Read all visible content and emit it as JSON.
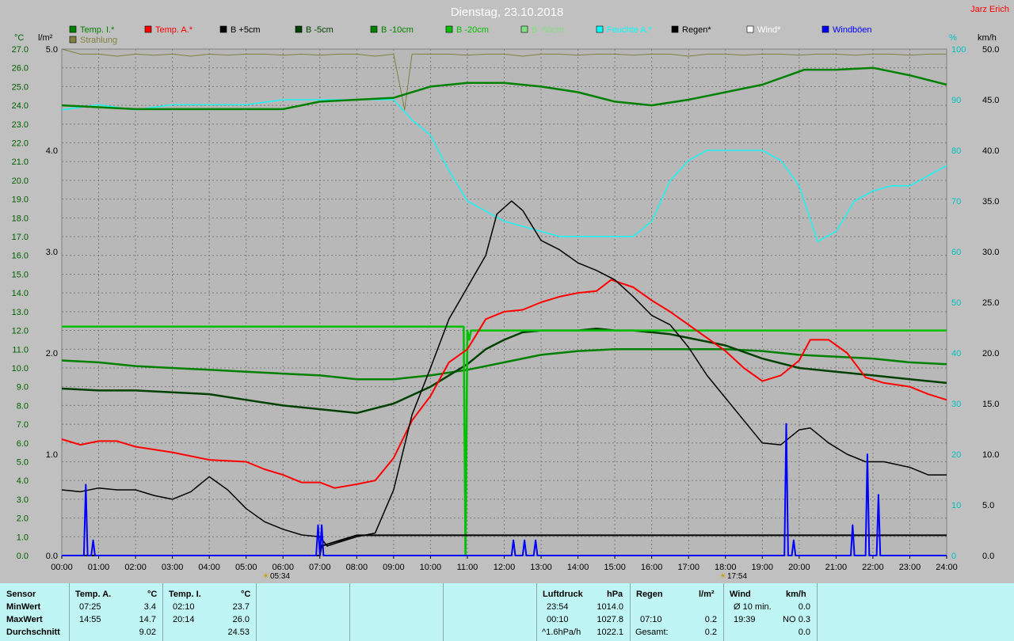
{
  "title": "Dienstag, 23.10.2018",
  "author": "Jarz Erich",
  "axis_units": {
    "temp": "°C",
    "rain": "l/m²",
    "humidity": "%",
    "wind": "km/h"
  },
  "legend": [
    {
      "label": "Temp. I.*",
      "color": "#008000"
    },
    {
      "label": "Temp. A.*",
      "color": "#ff0000"
    },
    {
      "label": "B +5cm",
      "color": "#000000"
    },
    {
      "label": "B -5cm",
      "color": "#004000"
    },
    {
      "label": "B -10cm",
      "color": "#008000"
    },
    {
      "label": "B -20cm",
      "color": "#00c000"
    },
    {
      "label": "B -50cm",
      "color": "#80e080"
    },
    {
      "label": "Feuchte A.*",
      "color": "#00ffff"
    },
    {
      "label": "Regen*",
      "color": "#000000"
    },
    {
      "label": "Wind*",
      "color": "#ffffff"
    },
    {
      "label": "Windböen",
      "color": "#0000ff"
    },
    {
      "label": "Strahlung",
      "color": "#808040"
    }
  ],
  "sun": {
    "sunrise": "05:34",
    "sunset": "17:54"
  },
  "chart_data": {
    "type": "line",
    "x_unit": "hours",
    "xlim": [
      0,
      24
    ],
    "x_ticks": [
      "00:00",
      "01:00",
      "02:00",
      "03:00",
      "04:00",
      "05:00",
      "06:00",
      "07:00",
      "08:00",
      "09:00",
      "10:00",
      "11:00",
      "12:00",
      "13:00",
      "14:00",
      "15:00",
      "16:00",
      "17:00",
      "18:00",
      "19:00",
      "20:00",
      "21:00",
      "22:00",
      "23:00",
      "24:00"
    ],
    "ylim_temp": [
      0,
      27
    ],
    "y_ticks_temp": [
      "0.0",
      "1.0",
      "2.0",
      "3.0",
      "4.0",
      "5.0",
      "6.0",
      "7.0",
      "8.0",
      "9.0",
      "10.0",
      "11.0",
      "12.0",
      "13.0",
      "14.0",
      "15.0",
      "16.0",
      "17.0",
      "18.0",
      "19.0",
      "20.0",
      "21.0",
      "22.0",
      "23.0",
      "24.0",
      "25.0",
      "26.0",
      "27.0"
    ],
    "ylim_rain": [
      0,
      5
    ],
    "y_ticks_rain": [
      "0.0",
      "1.0",
      "2.0",
      "3.0",
      "4.0",
      "5.0"
    ],
    "ylim_humidity": [
      0,
      100
    ],
    "y_ticks_humidity": [
      "0",
      "10",
      "20",
      "30",
      "40",
      "50",
      "60",
      "70",
      "80",
      "90",
      "100"
    ],
    "ylim_wind": [
      0,
      50
    ],
    "y_ticks_wind": [
      "0.0",
      "5.0",
      "10.0",
      "15.0",
      "20.0",
      "25.0",
      "30.0",
      "35.0",
      "40.0",
      "45.0",
      "50.0"
    ],
    "grid": true,
    "series": [
      {
        "name": "Temp. I.*",
        "axis": "temp",
        "color": "#008000",
        "x": [
          0,
          1,
          2,
          3,
          4,
          5,
          6,
          7,
          8,
          9,
          10,
          11,
          12,
          13,
          14,
          15,
          16,
          17,
          18,
          19,
          20,
          20.14,
          21,
          22,
          23,
          24
        ],
        "y": [
          24.0,
          23.9,
          23.8,
          23.8,
          23.8,
          23.8,
          23.8,
          24.2,
          24.3,
          24.4,
          25.0,
          25.2,
          25.2,
          25.0,
          24.7,
          24.2,
          24.0,
          24.3,
          24.7,
          25.1,
          25.8,
          25.9,
          25.9,
          26.0,
          25.6,
          25.1
        ]
      },
      {
        "name": "Temp. A.*",
        "axis": "temp",
        "color": "#ff0000",
        "x": [
          0,
          0.5,
          1,
          1.5,
          2,
          3,
          4,
          5,
          5.5,
          6,
          6.5,
          7,
          7.4,
          8,
          8.5,
          9,
          9.5,
          10,
          10.5,
          11,
          11.5,
          12,
          12.5,
          13,
          13.5,
          14,
          14.5,
          14.9,
          15.5,
          16,
          16.5,
          17,
          17.5,
          18,
          18.5,
          19,
          19.5,
          20,
          20.3,
          20.8,
          21.3,
          21.8,
          22.3,
          23,
          23.5,
          24
        ],
        "y": [
          6.2,
          5.9,
          6.1,
          6.1,
          5.8,
          5.5,
          5.1,
          5.0,
          4.6,
          4.3,
          3.9,
          3.9,
          3.6,
          3.8,
          4.0,
          5.2,
          7.2,
          8.5,
          10.3,
          11.0,
          12.6,
          13.0,
          13.1,
          13.5,
          13.8,
          14.0,
          14.1,
          14.7,
          14.3,
          13.6,
          13.0,
          12.3,
          11.6,
          10.9,
          10.0,
          9.3,
          9.6,
          10.4,
          11.5,
          11.5,
          10.8,
          9.5,
          9.2,
          9.0,
          8.6,
          8.3
        ]
      },
      {
        "name": "B +5cm",
        "axis": "temp",
        "color": "#000000",
        "x": [
          0,
          0.5,
          1,
          1.5,
          2,
          2.5,
          3,
          3.5,
          4,
          4.5,
          5,
          5.5,
          6,
          6.5,
          7,
          7.2,
          7.5,
          8,
          8.5,
          9,
          9.5,
          10,
          10.5,
          11,
          11.5,
          11.8,
          12.2,
          12.5,
          13,
          13.5,
          14,
          14.5,
          15,
          15.5,
          16,
          16.5,
          17,
          17.5,
          18,
          18.5,
          19,
          19.5,
          20,
          20.3,
          20.8,
          21.3,
          21.8,
          22.3,
          23,
          23.5,
          24
        ],
        "y": [
          3.5,
          3.4,
          3.6,
          3.5,
          3.5,
          3.2,
          3.0,
          3.4,
          4.2,
          3.5,
          2.5,
          1.8,
          1.4,
          1.1,
          1.0,
          0.5,
          0.7,
          1.0,
          1.2,
          3.5,
          7.5,
          10.0,
          12.6,
          14.3,
          16.0,
          18.2,
          18.9,
          18.4,
          16.8,
          16.3,
          15.6,
          15.2,
          14.7,
          13.8,
          12.8,
          12.3,
          11.1,
          9.6,
          8.4,
          7.2,
          6.0,
          5.9,
          6.7,
          6.8,
          6.0,
          5.4,
          5.0,
          5.0,
          4.7,
          4.3,
          4.3
        ]
      },
      {
        "name": "B -5cm",
        "axis": "temp",
        "color": "#004000",
        "x": [
          0,
          1,
          2,
          3,
          4,
          5,
          6,
          7,
          8,
          9,
          10,
          10.5,
          11,
          11.5,
          12,
          12.5,
          13,
          13.5,
          14,
          14.5,
          15,
          15.5,
          16,
          16.5,
          17,
          18,
          19,
          20,
          21,
          22,
          23,
          24
        ],
        "y": [
          8.9,
          8.8,
          8.8,
          8.7,
          8.6,
          8.3,
          8.0,
          7.8,
          7.6,
          8.1,
          9.0,
          9.6,
          10.2,
          11.0,
          11.5,
          11.9,
          12.0,
          12.0,
          12.0,
          12.1,
          12.0,
          12.0,
          11.9,
          11.8,
          11.6,
          11.2,
          10.5,
          10.0,
          9.8,
          9.6,
          9.4,
          9.2
        ]
      },
      {
        "name": "B -10cm",
        "axis": "temp",
        "color": "#008000",
        "x": [
          0,
          1,
          2,
          3,
          4,
          5,
          6,
          7,
          8,
          9,
          10,
          11,
          12,
          13,
          14,
          15,
          16,
          17,
          18,
          19,
          20,
          21,
          22,
          23,
          24
        ],
        "y": [
          10.4,
          10.3,
          10.1,
          10.0,
          9.9,
          9.8,
          9.7,
          9.6,
          9.4,
          9.4,
          9.6,
          9.9,
          10.3,
          10.7,
          10.9,
          11.0,
          11.0,
          11.0,
          11.0,
          10.9,
          10.7,
          10.6,
          10.5,
          10.3,
          10.2
        ]
      },
      {
        "name": "B -20cm",
        "axis": "temp",
        "color": "#00c000",
        "x": [
          0,
          10.9,
          10.95,
          11.0,
          11.05,
          11.1,
          24
        ],
        "y": [
          12.2,
          12.2,
          0,
          12.0,
          11.5,
          12.0,
          12.0
        ]
      },
      {
        "name": "Feuchte A.*",
        "axis": "humidity",
        "color": "#00ffff",
        "x": [
          0,
          1,
          2,
          3,
          4,
          5,
          6,
          7,
          8,
          9,
          9.5,
          10,
          10.5,
          11,
          11.5,
          12,
          12.5,
          13,
          13.5,
          14,
          14.5,
          15,
          15.5,
          16,
          16.5,
          17,
          17.5,
          18,
          18.5,
          19,
          19.5,
          20,
          20.5,
          21,
          21.5,
          22,
          22.5,
          23,
          23.5,
          24
        ],
        "y": [
          88,
          89,
          88,
          89,
          89,
          89,
          90,
          90,
          90,
          90,
          86,
          83,
          76,
          70,
          68,
          66,
          65,
          64,
          63,
          63,
          63,
          63,
          63,
          66,
          74,
          78,
          80,
          80,
          80,
          80,
          78,
          73,
          62,
          64,
          70,
          72,
          73,
          73,
          75,
          77
        ]
      },
      {
        "name": "Regen*",
        "axis": "rain",
        "color": "#000000",
        "x": [
          0,
          7.0,
          7.05,
          7.1,
          8.0,
          9.0,
          24
        ],
        "y": [
          0,
          0,
          0.1,
          0.1,
          0.2,
          0.2,
          0.2
        ]
      },
      {
        "name": "Windböen",
        "axis": "wind",
        "color": "#0000ff",
        "x": [
          0,
          0.6,
          0.65,
          0.7,
          0.8,
          0.85,
          0.9,
          6.9,
          6.95,
          7.0,
          7.05,
          7.1,
          12.2,
          12.25,
          12.3,
          12.5,
          12.55,
          12.6,
          12.8,
          12.85,
          12.9,
          19.6,
          19.65,
          19.7,
          19.8,
          19.85,
          19.9,
          21.4,
          21.45,
          21.5,
          21.8,
          21.85,
          21.9,
          22.1,
          22.15,
          22.2,
          24
        ],
        "y": [
          0,
          0,
          7,
          0,
          0,
          1.5,
          0,
          0,
          3,
          0,
          3,
          0,
          0,
          1.5,
          0,
          0,
          1.5,
          0,
          0,
          1.5,
          0,
          0,
          13,
          0,
          0,
          1.5,
          0,
          0,
          3,
          0,
          0,
          10,
          0,
          0,
          6,
          0,
          0
        ]
      },
      {
        "name": "Strahlung",
        "axis": "rain",
        "color": "#808040",
        "x": [
          0,
          0.5,
          1,
          1.5,
          2,
          2.5,
          3,
          3.5,
          4,
          4.5,
          5,
          5.5,
          6,
          6.5,
          7,
          7.5,
          8,
          8.5,
          9,
          9.3,
          9.5,
          10,
          10.5,
          11,
          11.5,
          12,
          12.5,
          13,
          13.5,
          14,
          14.5,
          15,
          15.5,
          16,
          16.5,
          17,
          17.5,
          18,
          18.5,
          19,
          19.5,
          20,
          20.5,
          21,
          21.5,
          22,
          22.5,
          23,
          23.5,
          24
        ],
        "y": [
          5.0,
          4.95,
          4.95,
          4.93,
          4.95,
          4.94,
          4.95,
          4.93,
          4.95,
          4.94,
          4.95,
          4.95,
          4.94,
          4.95,
          4.94,
          4.95,
          4.95,
          4.93,
          4.95,
          4.4,
          4.95,
          4.95,
          4.95,
          4.94,
          4.95,
          4.95,
          4.93,
          4.95,
          4.95,
          4.94,
          4.95,
          4.95,
          4.94,
          4.95,
          4.95,
          4.93,
          4.95,
          4.95,
          4.94,
          4.95,
          4.95,
          4.94,
          4.95,
          4.95,
          4.94,
          4.95,
          4.95,
          4.94,
          4.95,
          4.95
        ]
      }
    ]
  },
  "stats": {
    "sensor": {
      "header": "Sensor",
      "rows": [
        "MinWert",
        "MaxWert",
        "Durchschnitt"
      ]
    },
    "temp_a": {
      "header": "Temp. A.",
      "unit": "°C",
      "min_time": "07:25",
      "min": "3.4",
      "max_time": "14:55",
      "max": "14.7",
      "avg": "9.02"
    },
    "temp_i": {
      "header": "Temp. I.",
      "unit": "°C",
      "min_time": "02:10",
      "min": "23.7",
      "max_time": "20:14",
      "max": "26.0",
      "avg": "24.53"
    },
    "pressure": {
      "header": "Luftdruck",
      "unit": "hPa",
      "min_time": "23:54",
      "min": "1014.0",
      "max_time": "00:10",
      "max": "1027.8",
      "trend_label": "^1.6hPa/h",
      "trend_value": "1022.1"
    },
    "rain": {
      "header": "Regen",
      "unit": "l/m²",
      "max_time": "07:10",
      "max": "0.2",
      "total_label": "Gesamt:",
      "total": "0.2"
    },
    "wind": {
      "header": "Wind",
      "unit": "km/h",
      "avg_label": "Ø 10 min.",
      "avg": "0.0",
      "max_time": "19:39",
      "max_dir": "NO",
      "max": "0.3",
      "last": "0.0"
    }
  }
}
